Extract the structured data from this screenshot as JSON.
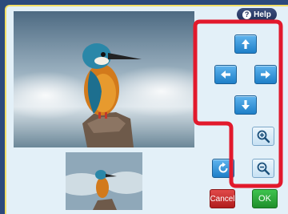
{
  "help_label": "Help",
  "help_glyph": "?",
  "buttons": {
    "move_up": "move-up",
    "move_left": "move-left",
    "move_right": "move-right",
    "move_down": "move-down",
    "zoom_in": "zoom-in",
    "zoom_out": "zoom-out",
    "rotate": "rotate",
    "cancel_label": "Cancel",
    "ok_label": "OK"
  },
  "colors": {
    "panel_bg": "#e3f0f8",
    "button_blue": "#1e7fc8",
    "cancel_red": "#c0282b",
    "ok_green": "#2aa63a",
    "highlight_red": "#e2192c"
  }
}
